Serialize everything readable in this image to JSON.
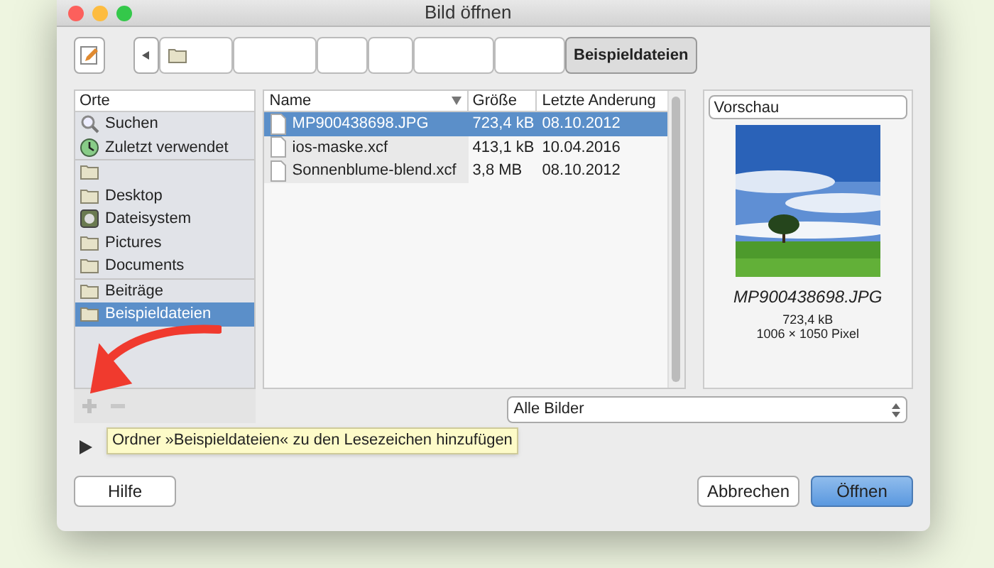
{
  "window": {
    "title": "Bild öffnen"
  },
  "path_bar": {
    "segments": [
      {
        "kind": "folder",
        "selected": false
      },
      {
        "kind": "blank",
        "selected": false
      },
      {
        "kind": "blank",
        "selected": false
      },
      {
        "kind": "blank",
        "selected": false
      },
      {
        "kind": "blank",
        "selected": false
      },
      {
        "kind": "blank",
        "selected": false
      },
      {
        "kind": "text",
        "label": "Beispieldateien",
        "selected": true
      }
    ]
  },
  "places": {
    "header": "Orte",
    "sections": [
      {
        "items": [
          {
            "kind": "search",
            "label": "Suchen",
            "selected": false
          },
          {
            "kind": "recent",
            "label": "Zuletzt verwendet",
            "selected": false
          }
        ]
      },
      {
        "items": [
          {
            "kind": "folder",
            "selected": false
          },
          {
            "kind": "folder",
            "label": "Desktop",
            "selected": false
          },
          {
            "kind": "drive",
            "label": "Dateisystem",
            "selected": false
          },
          {
            "kind": "folder",
            "label": "Pictures",
            "selected": false
          },
          {
            "kind": "folder",
            "label": "Documents",
            "selected": false
          }
        ]
      },
      {
        "items": [
          {
            "kind": "folder",
            "label": "Beiträge",
            "selected": false
          },
          {
            "kind": "folder",
            "label": "Beispieldateien",
            "selected": true
          }
        ]
      }
    ]
  },
  "files": {
    "columns": [
      "Name",
      "Größe",
      "Letzte Anderung"
    ],
    "rows": [
      {
        "name": "MP900438698.JPG",
        "size": "723,4 kB",
        "date": "08.10.2012",
        "selected": true
      },
      {
        "name": "ios-maske.xcf",
        "size": "413,1 kB",
        "date": "10.04.2016",
        "selected": false
      },
      {
        "name": "Sonnenblume-blend.xcf",
        "size": "3,8 MB",
        "date": "08.10.2012",
        "selected": false
      }
    ]
  },
  "preview": {
    "header": "Vorschau",
    "filename": "MP900438698.JPG",
    "size": "723,4 kB",
    "dimensions": "1006 × 1050 Pixel"
  },
  "filter": {
    "value": "Alle Bilder"
  },
  "tooltip": "Ordner »Beispieldateien« zu den Lesezeichen hinzufügen",
  "buttons": {
    "help": "Hilfe",
    "cancel": "Abbrechen",
    "open": "Öffnen"
  }
}
